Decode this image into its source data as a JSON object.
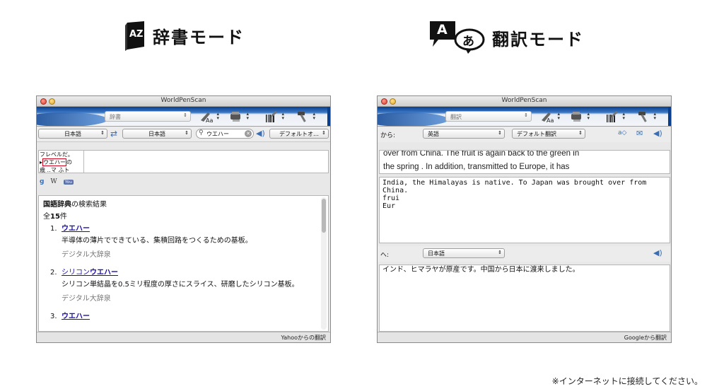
{
  "headings": {
    "dict_label": "辞書モード",
    "dict_icon_text": "AZ",
    "trans_label": "翻訳モード",
    "trans_icon_a": "A",
    "trans_icon_b": "あ"
  },
  "dict_window": {
    "title": "WorldPenScan",
    "mode_select": "辞書",
    "from_lang": "日本語",
    "to_lang": "日本語",
    "search_value": "ウエハー",
    "voice_select": "デフォルトオ…",
    "scan_text": {
      "line1": "フレベルだ。",
      "line2_before": "▸",
      "line2_highlight": "ウエハー",
      "line2_after": "の",
      "line3": "歳 ‥マ ふト"
    },
    "sources": {
      "google": "g",
      "wikipedia": "W",
      "youtube": "You"
    },
    "results": {
      "header_bold": "国語辞典",
      "header_rest": "の検索結果",
      "count_prefix": "全",
      "count_num": "15",
      "count_suffix": "件",
      "items": [
        {
          "num": "1.",
          "link_pre": "",
          "link_bold": "ウエハー",
          "def": "半導体の薄片でできている、集積回路をつくるための基板。",
          "source": "デジタル大辞泉"
        },
        {
          "num": "2.",
          "link_pre": "シリコン",
          "link_bold": "ウエハー",
          "def": "シリコン単結晶を0.5ミリ程度の厚さにスライス、研磨したシリコン基板。",
          "source": "デジタル大辞泉"
        },
        {
          "num": "3.",
          "link_pre": "",
          "link_bold": "ウエハー",
          "def": "",
          "source": ""
        }
      ]
    },
    "status": "Yahooからの翻訳"
  },
  "trans_window": {
    "title": "WorldPenScan",
    "mode_select": "翻訳",
    "from_label": "から:",
    "from_lang": "英語",
    "engine_select": "デフォルト翻訳",
    "scan_lines": [
      "over from China. The fruit is again back to the green in",
      "the spring . In addition, transmitted to Europe, it has"
    ],
    "source_text": [
      "India, the Himalayas is native. To Japan was brought over from China.",
      "frui",
      "Eur"
    ],
    "to_label": "へ:",
    "to_lang": "日本語",
    "result_text": "インド、ヒマラヤが原産です。中国から日本に渡来しました。",
    "status": "Googleから翻訳"
  },
  "footer_note": "※インターネットに接続してください。",
  "colors": {
    "toolbar_blue": "#0a3f8d",
    "link": "#1a0dab",
    "highlight_red": "#d0021b"
  }
}
